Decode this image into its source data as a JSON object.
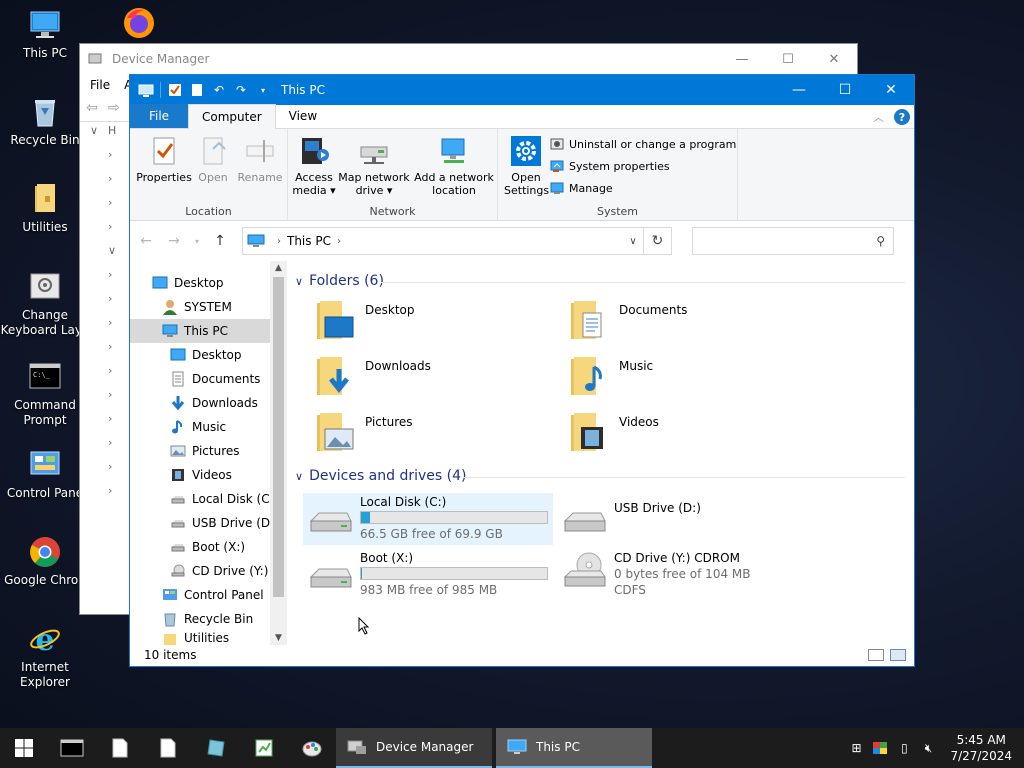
{
  "desktop": {
    "icons": [
      {
        "label": "This PC"
      },
      {
        "label": "Recycle Bin"
      },
      {
        "label": "Utilities"
      },
      {
        "label": "Change Keyboard Layo"
      },
      {
        "label": "Command Prompt"
      },
      {
        "label": "Control Pane"
      },
      {
        "label": "Google Chron"
      },
      {
        "label": "Internet Explorer"
      }
    ]
  },
  "device_manager": {
    "title": "Device Manager",
    "menu": [
      "File",
      "A"
    ],
    "tree_hint": "H"
  },
  "explorer": {
    "title": "This PC",
    "tabs": {
      "file": "File",
      "computer": "Computer",
      "view": "View"
    },
    "ribbon": {
      "location": {
        "name": "Location",
        "properties": "Properties",
        "open": "Open",
        "rename": "Rename"
      },
      "network": {
        "name": "Network",
        "access_media_1": "Access",
        "access_media_2": "media ▾",
        "map_drive_1": "Map network",
        "map_drive_2": "drive ▾",
        "add_location_1": "Add a network",
        "add_location_2": "location"
      },
      "system": {
        "name": "System",
        "open_settings_1": "Open",
        "open_settings_2": "Settings",
        "uninstall": "Uninstall or change a program",
        "sys_props": "System properties",
        "manage": "Manage"
      }
    },
    "address": {
      "crumb": "This PC",
      "search_placeholder": ""
    },
    "nav": {
      "items": [
        "Desktop",
        "SYSTEM",
        "This PC",
        "Desktop",
        "Documents",
        "Downloads",
        "Music",
        "Pictures",
        "Videos",
        "Local Disk (C:)",
        "USB Drive (D:)",
        "Boot (X:)",
        "CD Drive (Y:) C",
        "Control Panel",
        "Recycle Bin",
        "Utilities"
      ]
    },
    "folders": {
      "header": "Folders (6)",
      "items": [
        "Desktop",
        "Documents",
        "Downloads",
        "Music",
        "Pictures",
        "Videos"
      ]
    },
    "drives": {
      "header": "Devices and drives (4)",
      "local_c": {
        "name": "Local Disk (C:)",
        "free": "66.5 GB free of 69.9 GB",
        "used_fraction": 0.049
      },
      "usb_d": {
        "name": "USB Drive (D:)"
      },
      "boot_x": {
        "name": "Boot (X:)",
        "free": "983 MB free of 985 MB",
        "used_fraction": 0.002
      },
      "cd_y": {
        "name": "CD Drive (Y:) CDROM",
        "free": "0 bytes free of 104 MB",
        "fs": "CDFS"
      }
    },
    "status": {
      "count": "10 items"
    }
  },
  "taskbar": {
    "apps": [
      {
        "label": "Device Manager"
      },
      {
        "label": "This PC"
      }
    ],
    "time": "5:45 AM",
    "date": "7/27/2024"
  }
}
